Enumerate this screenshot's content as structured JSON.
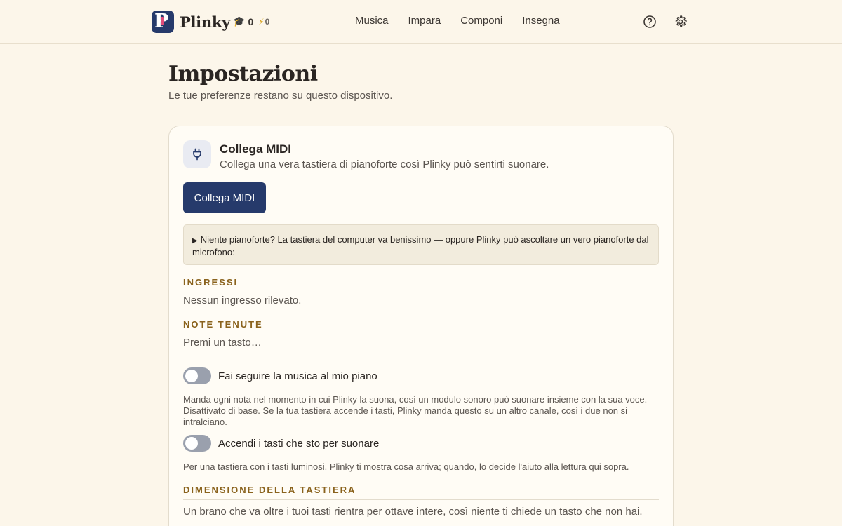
{
  "header": {
    "brand": "Plinky",
    "logo_letter": "P",
    "graduation_count": "0",
    "energy_count": "0",
    "nav": [
      "Musica",
      "Impara",
      "Componi",
      "Insegna"
    ],
    "icons": {
      "help": "help-circle-icon",
      "settings": "gear-icon"
    }
  },
  "page": {
    "title": "Impostazioni",
    "subtitle": "Le tue preferenze restano su questo dispositivo."
  },
  "midi_card": {
    "icon": "plug-icon",
    "title": "Collega MIDI",
    "description": "Collega una vera tastiera di pianoforte così Plinky può sentirti suonare.",
    "button_label": "Collega MIDI",
    "details_summary": "Niente pianoforte? La tastiera del computer va benissimo — oppure Plinky può ascoltare un vero pianoforte dal microfono:",
    "inputs_label": "INGRESSI",
    "inputs_value": "Nessun ingresso rilevato.",
    "held_notes_label": "NOTE TENUTE",
    "held_notes_value": "Premi un tasto…",
    "toggles": [
      {
        "label": "Fai seguire la musica al mio piano",
        "on": false,
        "help": "Manda ogni nota nel momento in cui Plinky la suona, così un modulo sonoro può suonare insieme con la sua voce. Disattivato di base. Se la tua tastiera accende i tasti, Plinky manda questo su un altro canale, così i due non si intralciano."
      },
      {
        "label": "Accendi i tasti che sto per suonare",
        "on": false,
        "help": "Per una tastiera con i tasti luminosi. Plinky ti mostra cosa arriva; quando, lo decide l'aiuto alla lettura qui sopra."
      }
    ],
    "keyboard_size_label": "DIMENSIONE DELLA TASTIERA",
    "keyboard_size_text": "Un brano che va oltre i tuoi tasti rientra per ottave intere, così niente ti chiede un tasto che non hai."
  },
  "colors": {
    "background": "#fcf6ea",
    "accent": "#263a6b",
    "section_label": "#8a621c",
    "toggle_off": "#9aa0ad"
  }
}
